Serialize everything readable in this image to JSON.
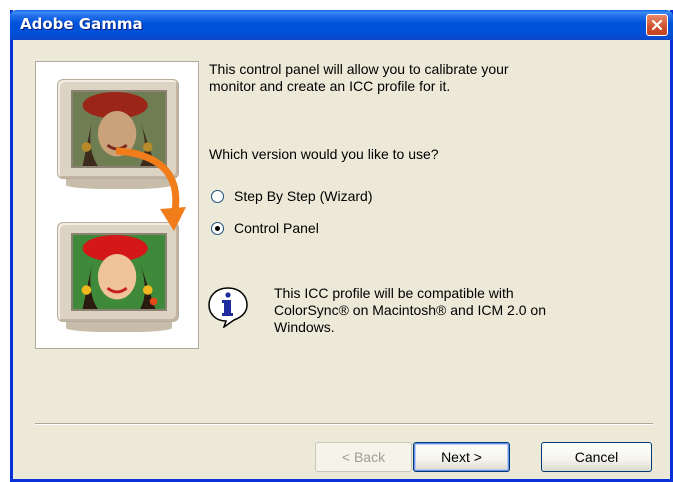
{
  "window": {
    "title": "Adobe Gamma"
  },
  "intro_text": "This control panel will allow you to calibrate your monitor and create an ICC profile for it.",
  "question_text": "Which version would you like to use?",
  "options": [
    {
      "label": "Step By Step (Wizard)",
      "selected": false
    },
    {
      "label": "Control Panel",
      "selected": true
    }
  ],
  "info": {
    "icon": "info-speech-bubble-icon",
    "text": "This ICC profile will be compatible with ColorSync® on Macintosh® and ICM 2.0 on Windows."
  },
  "buttons": {
    "back": "< Back",
    "next": "Next >",
    "cancel": "Cancel"
  },
  "colors": {
    "titlebar": "#0052dc",
    "dialog_bg": "#ece9d8",
    "close_button": "#d0512e",
    "arrow": "#f07c1a"
  }
}
